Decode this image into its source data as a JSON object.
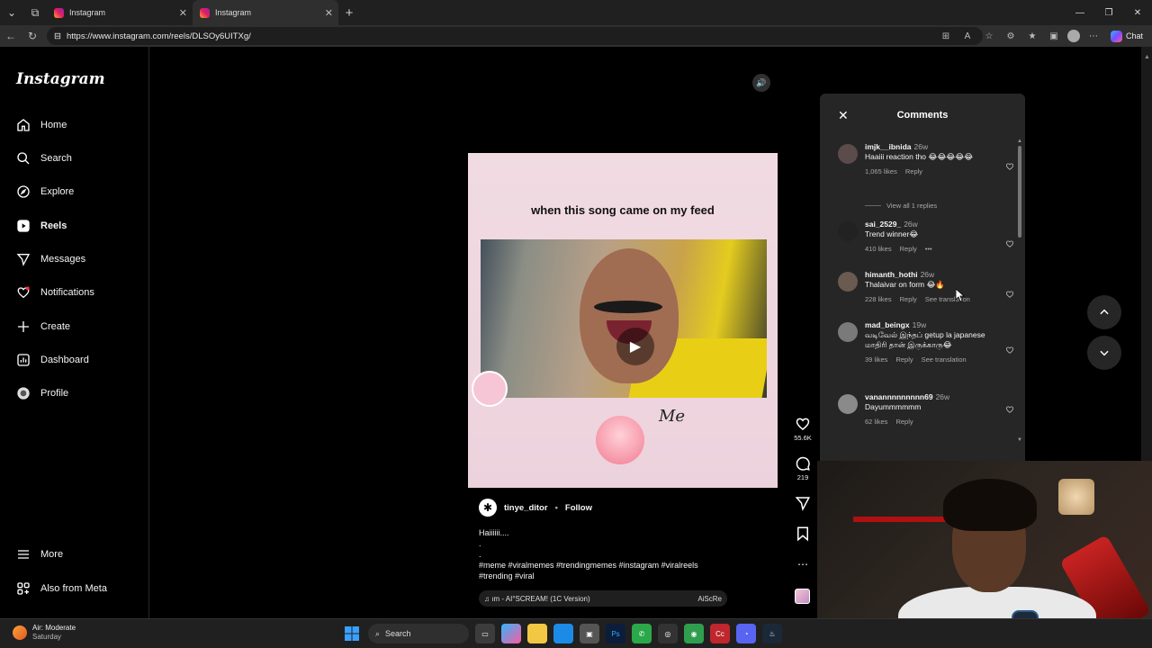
{
  "browser": {
    "tabs": [
      {
        "title": "Instagram"
      },
      {
        "title": "Instagram"
      }
    ],
    "url": "https://www.instagram.com/reels/DLSOy6UITXg/",
    "chat_label": "Chat"
  },
  "sidebar": {
    "logo": "Instagram",
    "items": [
      {
        "label": "Home",
        "icon": "home-icon"
      },
      {
        "label": "Search",
        "icon": "search-icon"
      },
      {
        "label": "Explore",
        "icon": "compass-icon"
      },
      {
        "label": "Reels",
        "icon": "reels-icon"
      },
      {
        "label": "Messages",
        "icon": "messages-icon"
      },
      {
        "label": "Notifications",
        "icon": "heart-icon"
      },
      {
        "label": "Create",
        "icon": "plus-icon"
      },
      {
        "label": "Dashboard",
        "icon": "dashboard-icon"
      },
      {
        "label": "Profile",
        "icon": "profile-icon"
      }
    ],
    "more_label": "More",
    "meta_label": "Also from Meta"
  },
  "reel": {
    "overlay_text": "when this song came on my feed",
    "sticker_text": "Me",
    "author": "tinye_ditor",
    "follow_label": "Follow",
    "caption": "Haiiiiii....\n.\n.\n#meme #viralmemes #trendingmemes #instagram #viralreels\n#trending #viral",
    "audio": "♫ ım - AI°SCREAM! (1C Version)",
    "audio_right": "AiScRe",
    "likes": "55.6K",
    "comments_count": "219"
  },
  "comments": {
    "title": "Comments",
    "items": [
      {
        "user": "imjk__ibnida",
        "age": "26w",
        "text": "Haaiii reaction tho 😂😂😂😂😂",
        "likes": "1,065 likes",
        "reply": "Reply",
        "translation": "",
        "view_replies": "View all 1 replies"
      },
      {
        "user": "sai_2529_",
        "age": "26w",
        "text": "Trend winner😂",
        "likes": "410 likes",
        "reply": "Reply",
        "translation": "",
        "view_replies": ""
      },
      {
        "user": "himanth_hothi",
        "age": "26w",
        "text": "Thalaivar on form 😂🔥",
        "likes": "228 likes",
        "reply": "Reply",
        "translation": "See translation",
        "view_replies": ""
      },
      {
        "user": "mad_beingx",
        "age": "19w",
        "text": "வடிவேல் இந்தப் getup la japanese மாதிரி தான் இருக்காரு😂",
        "likes": "39 likes",
        "reply": "Reply",
        "translation": "See translation",
        "view_replies": ""
      },
      {
        "user": "vanannnnnnnnn69",
        "age": "26w",
        "text": "Dayummmmmm",
        "likes": "62 likes",
        "reply": "Reply",
        "translation": "",
        "view_replies": ""
      }
    ]
  },
  "taskbar": {
    "weather_title": "Air: Moderate",
    "weather_sub": "Saturday",
    "search_label": "Search"
  },
  "colors": {
    "accent": "#0095f6",
    "panel": "#262626",
    "bg": "#000000"
  }
}
